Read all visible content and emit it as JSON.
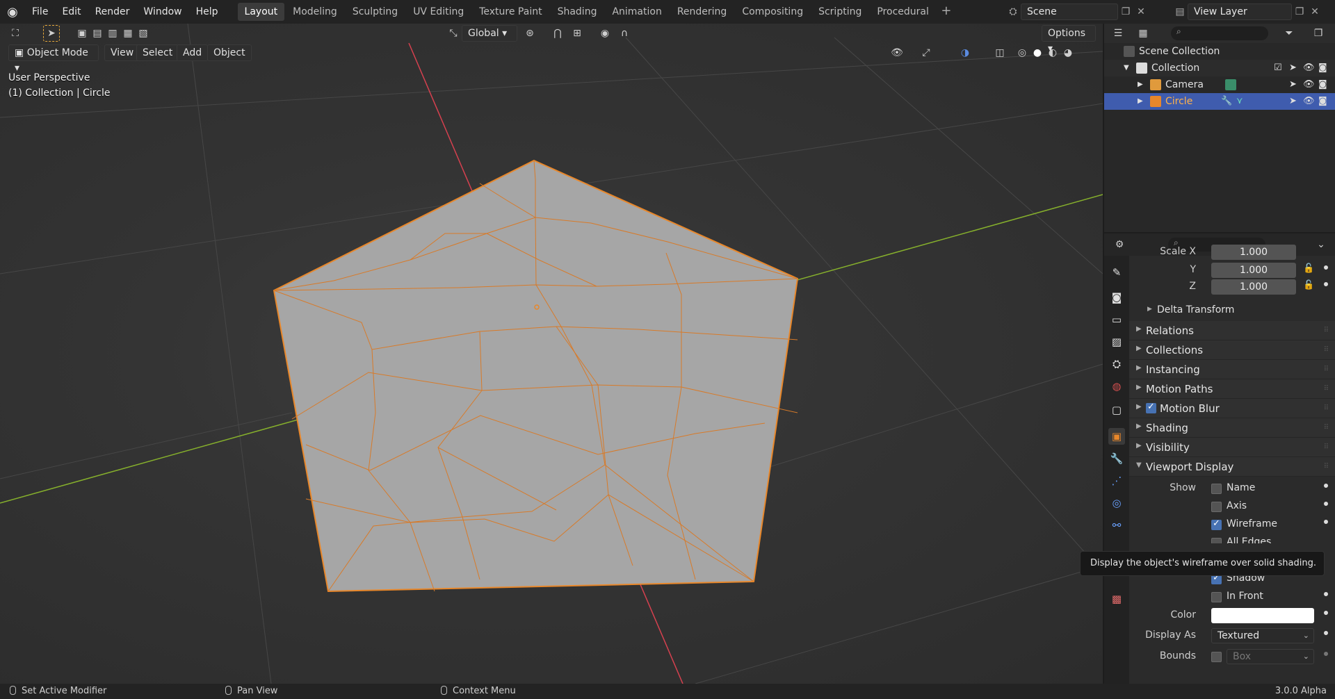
{
  "menu": [
    "File",
    "Edit",
    "Render",
    "Window",
    "Help"
  ],
  "workspaces": [
    "Layout",
    "Modeling",
    "Sculpting",
    "UV Editing",
    "Texture Paint",
    "Shading",
    "Animation",
    "Rendering",
    "Compositing",
    "Scripting",
    "Procedural"
  ],
  "active_workspace": "Layout",
  "scene": {
    "name": "Scene",
    "view_layer": "View Layer"
  },
  "viewport": {
    "mode": "Object Mode",
    "menus": [
      "View",
      "Select",
      "Add",
      "Object"
    ],
    "orientation": "Global",
    "options": "Options",
    "info_line1": "User Perspective",
    "info_line2": "(1) Collection | Circle"
  },
  "outliner": {
    "scene_collection": "Scene Collection",
    "collection": "Collection",
    "items": [
      "Camera",
      "Circle"
    ],
    "selected": "Circle"
  },
  "properties": {
    "scale": {
      "label_prefix": "Scale X",
      "x": "1.000",
      "y_label": "Y",
      "y": "1.000",
      "z_label": "Z",
      "z": "1.000"
    },
    "delta": "Delta Transform",
    "panels": [
      "Relations",
      "Collections",
      "Instancing",
      "Motion Paths",
      "Motion Blur",
      "Shading",
      "Visibility"
    ],
    "viewport_display": "Viewport Display",
    "show_label": "Show",
    "show_items": [
      {
        "label": "Name",
        "checked": false
      },
      {
        "label": "Axis",
        "checked": false
      },
      {
        "label": "Wireframe",
        "checked": true
      },
      {
        "label": "All Edges",
        "checked": false
      },
      {
        "label": "Shadow",
        "checked": true
      },
      {
        "label": "In Front",
        "checked": false
      }
    ],
    "color_label": "Color",
    "display_as_label": "Display As",
    "display_as": "Textured",
    "bounds_label": "Bounds",
    "bounds": "Box"
  },
  "tooltip": "Display the object's wireframe over solid shading.",
  "status": {
    "left": "Set Active Modifier",
    "middle": "Pan View",
    "right": "Context Menu",
    "version": "3.0.0 Alpha"
  },
  "colors": {
    "accent": "#4772b3",
    "selection": "#3f5cae",
    "wire": "#e8872a",
    "x_axis": "#d6414f",
    "y_axis": "#86b02c"
  }
}
